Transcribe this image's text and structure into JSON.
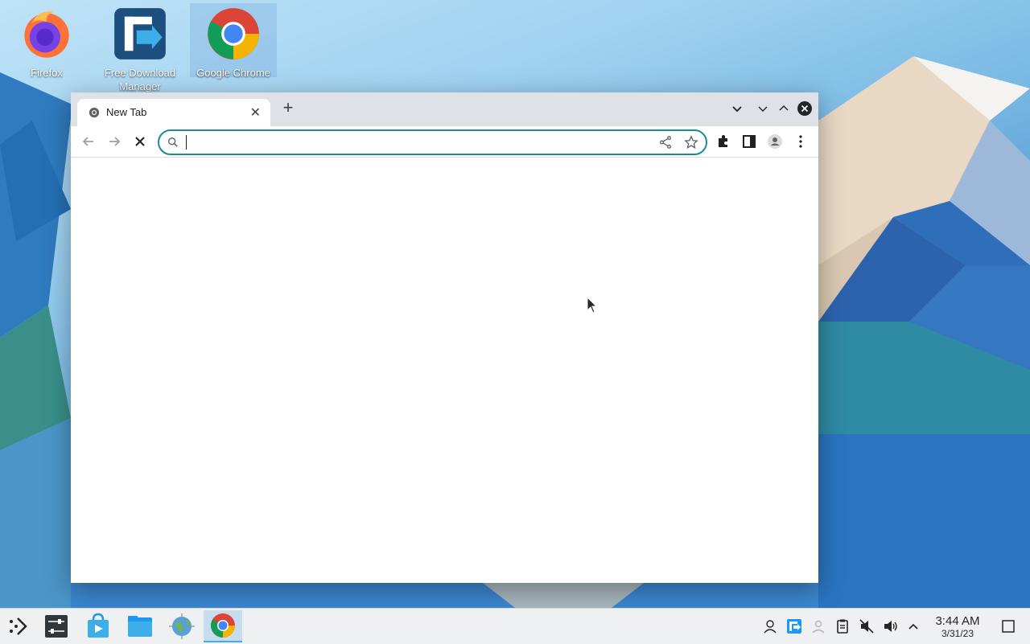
{
  "desktop": {
    "icons": [
      {
        "label": "Firefox"
      },
      {
        "label": "Free Download Manager"
      },
      {
        "label": "Google Chrome"
      }
    ]
  },
  "browser": {
    "tab": {
      "title": "New Tab"
    },
    "omnibox": {
      "value": "",
      "placeholder": ""
    }
  },
  "taskbar": {
    "clock": {
      "time": "3:44 AM",
      "date": "3/31/23"
    }
  },
  "colors": {
    "accent": "#1a8d91",
    "tab_strip": "#dee1e6",
    "taskbar": "#eff0f1"
  }
}
